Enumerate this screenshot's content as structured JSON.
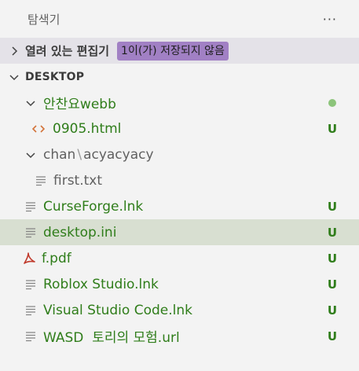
{
  "header": {
    "title": "탐색기",
    "more": "···"
  },
  "open_editors": {
    "label": "열려 있는 편집기",
    "badge": "1이(가) 저장되지 않음"
  },
  "desktop": {
    "label": "DESKTOP"
  },
  "tree": {
    "folder1": {
      "name": "안찬요webb"
    },
    "file_html": {
      "name": "0905.html",
      "status": "U"
    },
    "folder2": {
      "part1": "chan",
      "sep": "\\",
      "part2": "acyacyacy"
    },
    "file_txt": {
      "name": "first.txt"
    },
    "file_curse": {
      "name": "CurseForge.lnk",
      "status": "U"
    },
    "file_ini": {
      "name": "desktop.ini",
      "status": "U"
    },
    "file_pdf": {
      "name": "f.pdf",
      "status": "U"
    },
    "file_roblox": {
      "name": "Roblox Studio.lnk",
      "status": "U"
    },
    "file_vscode": {
      "name": "Visual Studio Code.lnk",
      "status": "U"
    },
    "file_wasd": {
      "name": "WASD  토리의 모험.url",
      "status": "U"
    }
  },
  "colors": {
    "modified": "#2f7d1a",
    "badge": "#a180c4",
    "selected": "#d8dfd1",
    "html_icon": "#d3743a",
    "pdf_icon": "#c0392b"
  },
  "icons": {
    "chevron_right": "chevron-right-icon",
    "chevron_down": "chevron-down-icon",
    "html": "html-file-icon",
    "text": "text-file-icon",
    "pdf": "pdf-file-icon"
  }
}
